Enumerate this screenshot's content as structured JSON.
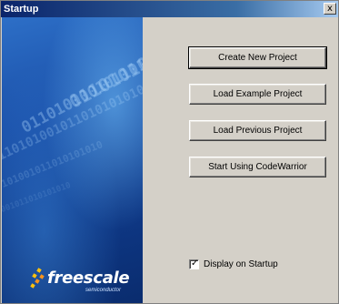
{
  "window": {
    "title": "Startup",
    "close_glyph": "x"
  },
  "banner": {
    "brand_name": "freescale",
    "brand_subtitle": "semiconductor",
    "decorative_digits": "0110101001011010101010"
  },
  "actions": [
    {
      "label": "Create New Project",
      "is_default": true
    },
    {
      "label": "Load Example Project",
      "is_default": false
    },
    {
      "label": "Load Previous Project",
      "is_default": false
    },
    {
      "label": "Start Using CodeWarrior",
      "is_default": false
    }
  ],
  "display_on_startup": {
    "label": "Display on Startup",
    "checked": true
  }
}
